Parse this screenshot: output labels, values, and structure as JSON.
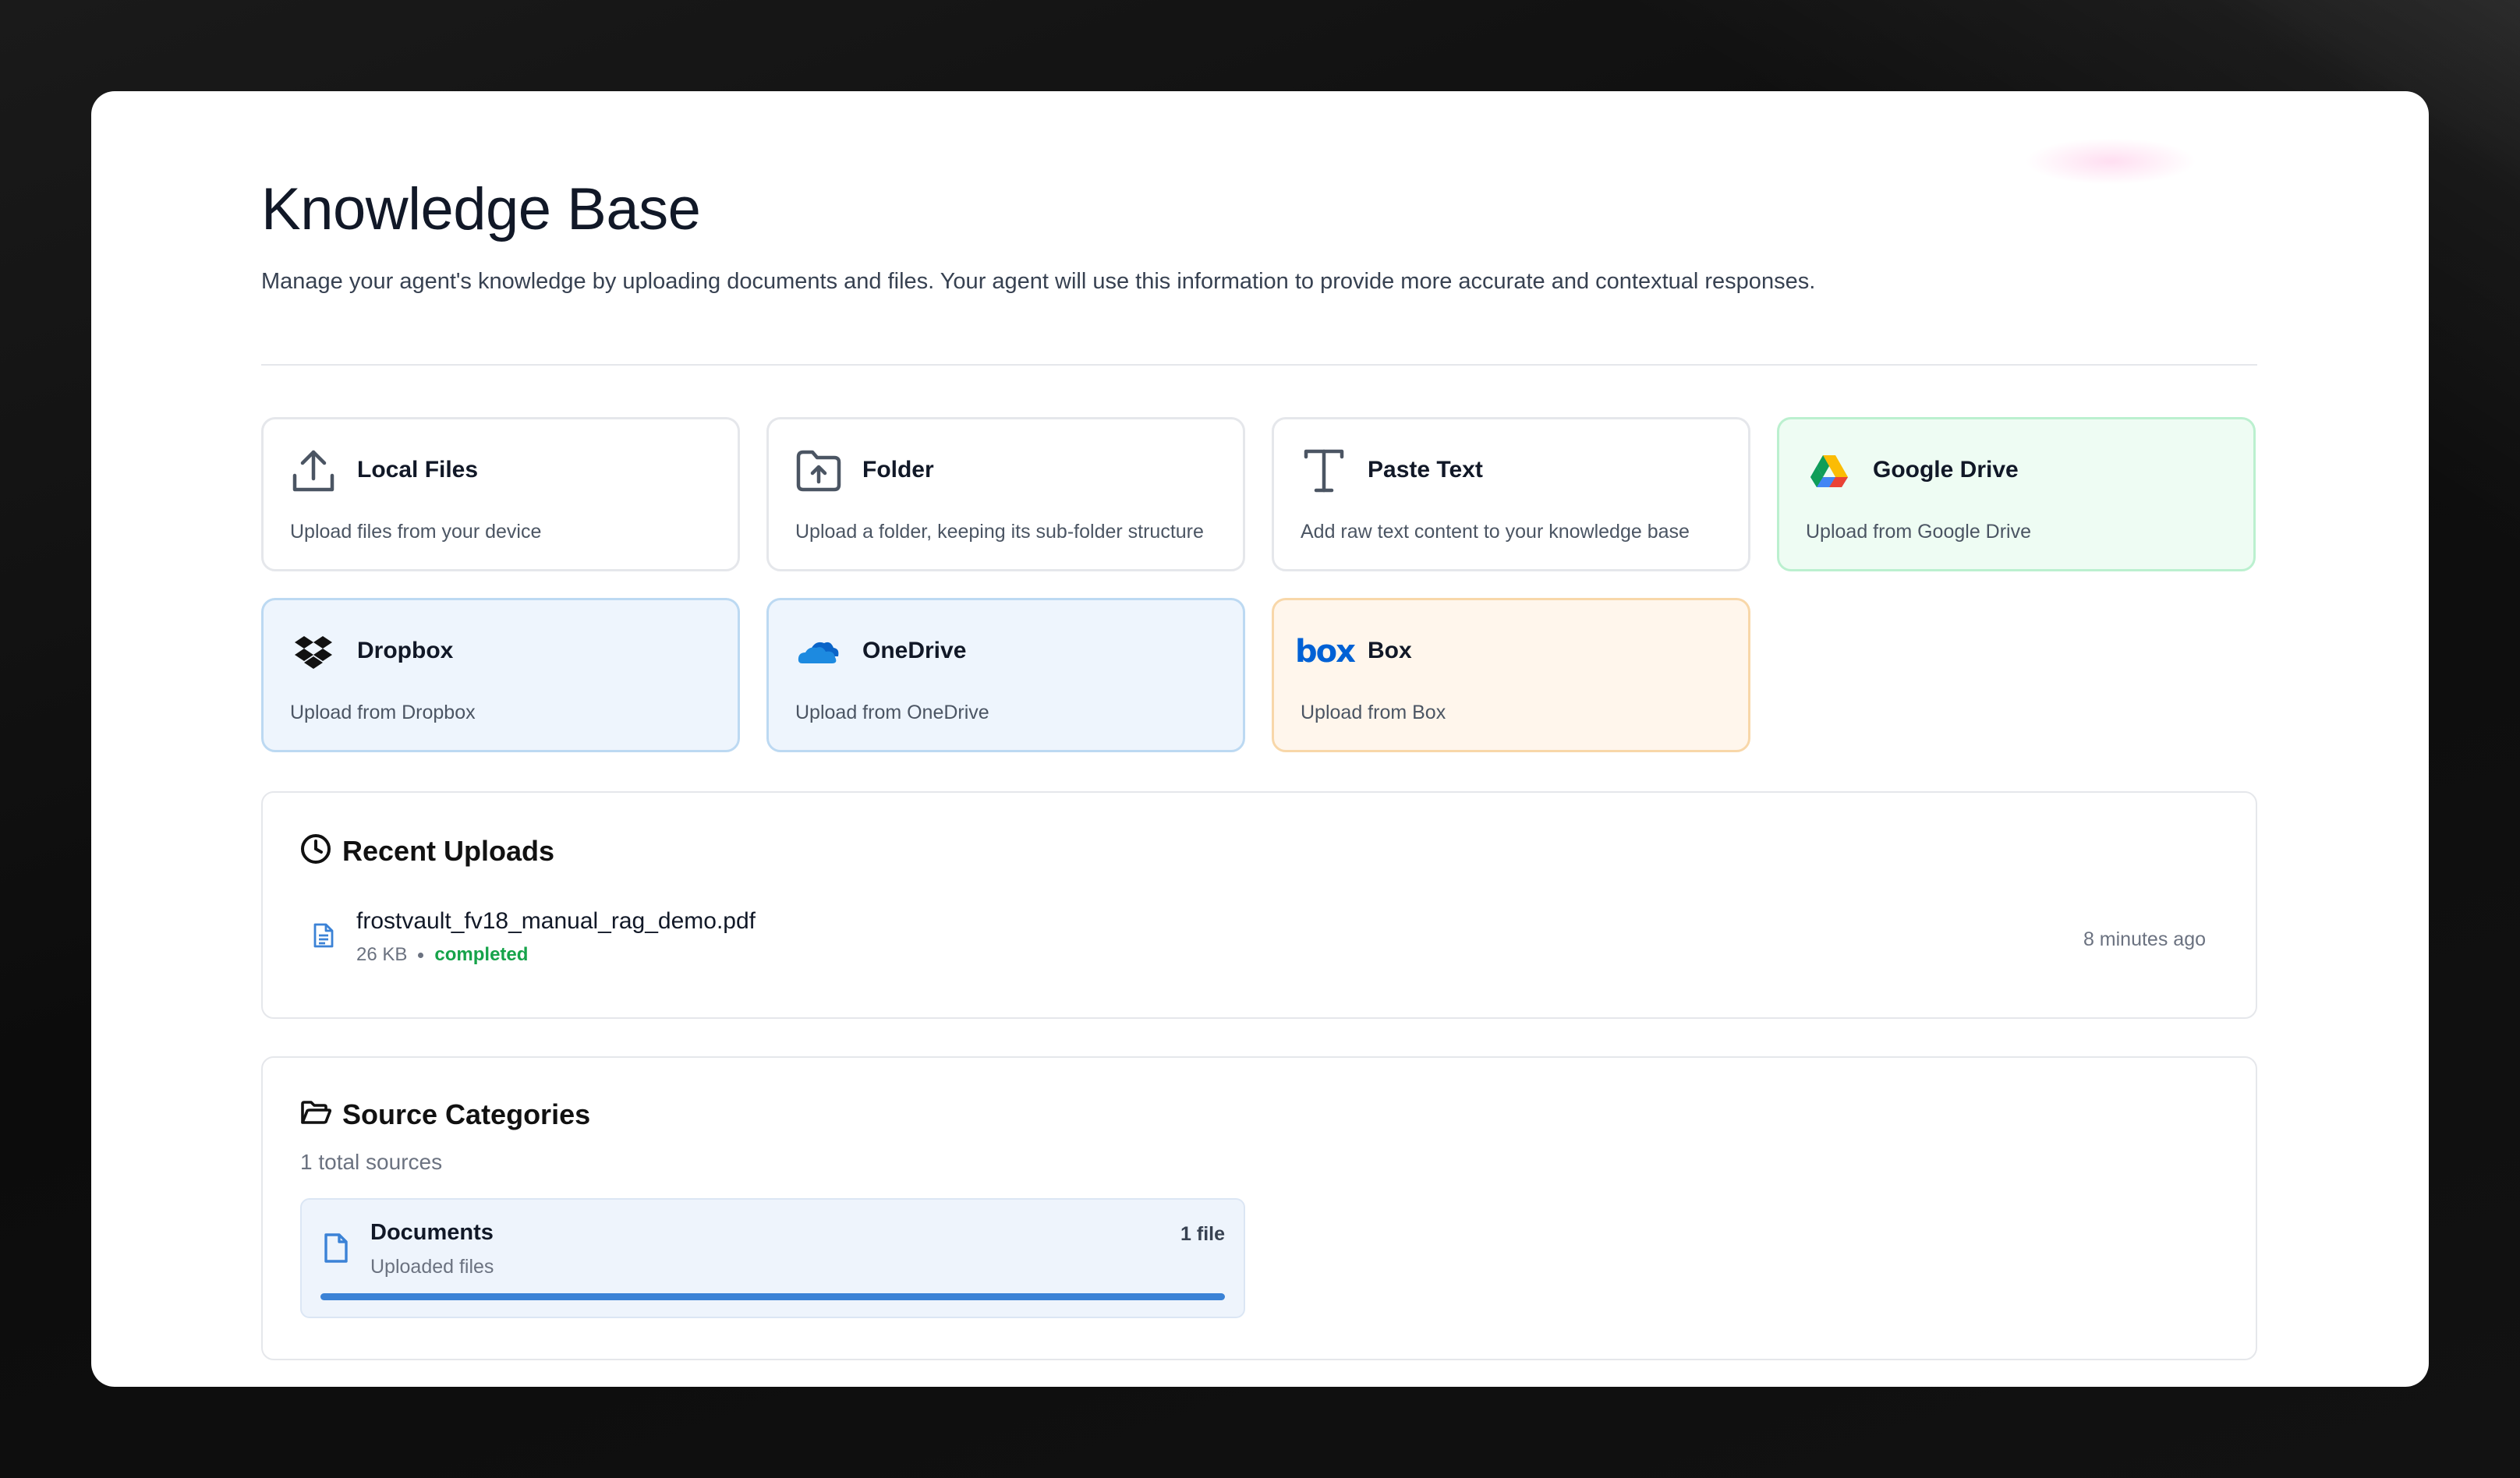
{
  "header": {
    "title": "Knowledge Base",
    "subtitle": "Manage your agent's knowledge by uploading documents and files. Your agent will use this information to provide more accurate and contextual responses."
  },
  "sources": [
    {
      "id": "local-files",
      "title": "Local Files",
      "desc": "Upload files from your device",
      "icon": "upload-icon"
    },
    {
      "id": "folder",
      "title": "Folder",
      "desc": "Upload a folder, keeping its sub-folder structure",
      "icon": "folder-upload-icon"
    },
    {
      "id": "paste-text",
      "title": "Paste Text",
      "desc": "Add raw text content to your knowledge base",
      "icon": "text-icon"
    },
    {
      "id": "google-drive",
      "title": "Google Drive",
      "desc": "Upload from Google Drive",
      "icon": "google-drive-icon"
    },
    {
      "id": "dropbox",
      "title": "Dropbox",
      "desc": "Upload from Dropbox",
      "icon": "dropbox-icon"
    },
    {
      "id": "onedrive",
      "title": "OneDrive",
      "desc": "Upload from OneDrive",
      "icon": "onedrive-icon"
    },
    {
      "id": "box",
      "title": "Box",
      "desc": "Upload from Box",
      "icon": "box-logo-icon",
      "logo_text": "box"
    }
  ],
  "recent_uploads": {
    "title": "Recent Uploads",
    "items": [
      {
        "name": "frostvault_fv18_manual_rag_demo.pdf",
        "size": "26 KB",
        "status": "completed",
        "time": "8 minutes ago"
      }
    ]
  },
  "source_categories": {
    "title": "Source Categories",
    "total": "1 total sources",
    "items": [
      {
        "name": "Documents",
        "sub": "Uploaded files",
        "count": "1 file",
        "progress": 1.0
      }
    ]
  },
  "colors": {
    "accent": "#3b82d6",
    "success": "#16a34a",
    "google_card_bg": "#eefcf3",
    "blue_card_bg": "#eef5fd",
    "orange_card_bg": "#fff6ec",
    "box_brand": "#0061d5",
    "dropbox_brand": "#111111",
    "onedrive_brand": "#1d8ae0"
  }
}
